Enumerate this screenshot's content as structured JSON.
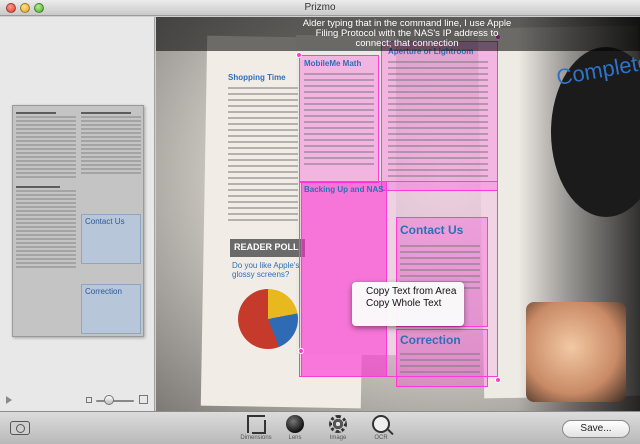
{
  "window": {
    "title": "Prizmo"
  },
  "tooltip": {
    "text": "Alder typing that in the command line, I use Apple Filing Protocol with the NAS's IP address to connect; that connection"
  },
  "context_menu": {
    "items": [
      {
        "label": "Copy Text from Area"
      },
      {
        "label": "Copy Whole Text"
      }
    ]
  },
  "page_text": {
    "mobileme_heading": "MobileMe Math",
    "aperture_heading": "Aperture or Lightroom",
    "shopping_heading": "Shopping Time",
    "backing_heading": "Backing Up and NAS",
    "contact_heading": "Contact Us",
    "correction_heading": "Correction",
    "poll_heading": "READER POLL",
    "poll_sub": "Do you like Apple's glossy screens?",
    "pie_label_1": "22%",
    "pie_label_2": "22%",
    "pie_label_3": "56%",
    "headline_right": "Complete"
  },
  "toolbar": {
    "tools": [
      {
        "label": "Dimensions",
        "icon": "crop-icon"
      },
      {
        "label": "Lens",
        "icon": "lens-icon"
      },
      {
        "label": "Image",
        "icon": "gear-icon"
      },
      {
        "label": "OCR",
        "icon": "ocr-icon"
      }
    ],
    "save_label": "Save..."
  },
  "colors": {
    "highlight": "#ff3bd8",
    "heading_blue": "#2e6fb8"
  }
}
